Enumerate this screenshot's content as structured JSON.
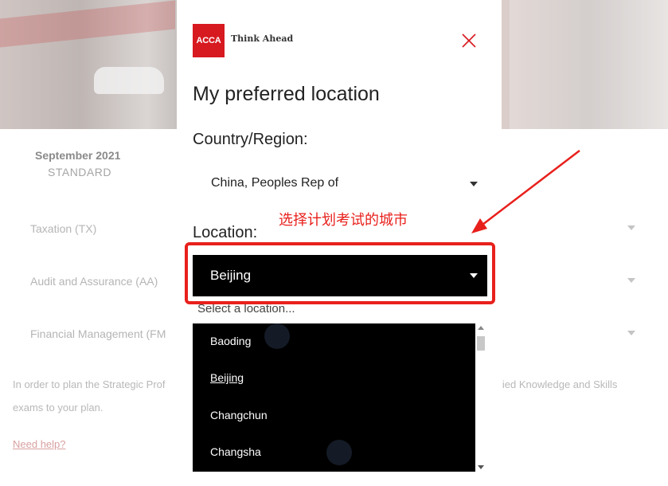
{
  "background": {
    "session": {
      "date": "September 2021",
      "type": "STANDARD"
    },
    "exams": [
      {
        "label": "Taxation (TX)"
      },
      {
        "label": "Audit and Assurance (AA)"
      },
      {
        "label": "Financial Management (FM"
      }
    ],
    "paragraph": {
      "left": "In order to plan the Strategic Prof",
      "right": "lied Knowledge and Skills",
      "line2": "exams to your plan."
    },
    "help_link": "Need help?"
  },
  "modal": {
    "logo_text": "ACCA",
    "tagline": "Think Ahead",
    "title": "My preferred location",
    "country_label": "Country/Region:",
    "country_value": "China, Peoples Rep of",
    "location_label": "Location:",
    "location_value": "Beijing",
    "location_placeholder": "Select a location...",
    "options": [
      "Baoding",
      "Beijing",
      "Changchun",
      "Changsha"
    ],
    "selected_option": "Beijing"
  },
  "annotation": {
    "text": "选择计划考试的城市",
    "color": "#e8201c"
  },
  "colors": {
    "brand_red": "#d71920",
    "dropdown_bg": "#000000"
  }
}
